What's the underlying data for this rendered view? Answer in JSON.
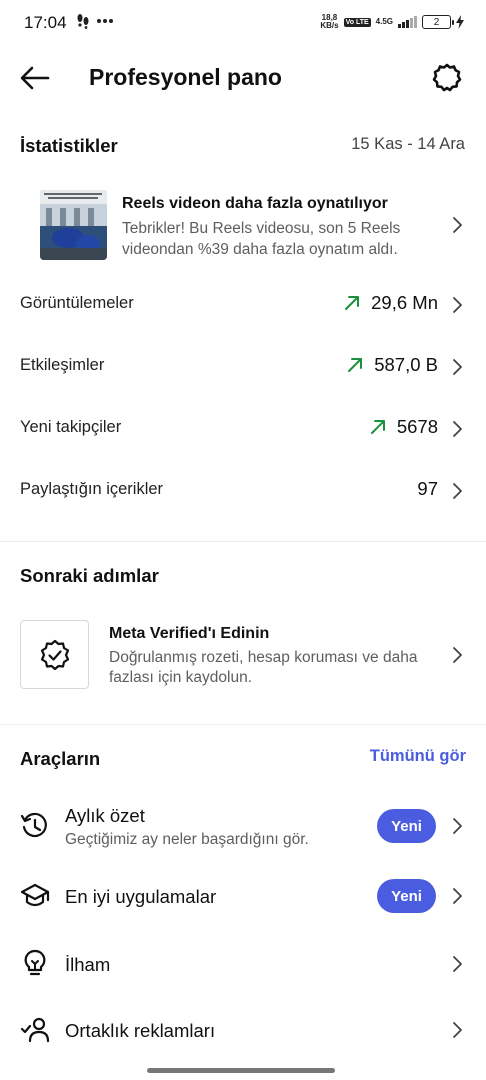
{
  "status_bar": {
    "time": "17:04",
    "net_speed_top": "18,8",
    "net_speed_bottom": "KB/s",
    "volte": "Vo LTE",
    "net_type": "4.5G",
    "battery": "2"
  },
  "header": {
    "title": "Profesyonel pano"
  },
  "stats": {
    "title": "İstatistikler",
    "date_range": "15 Kas - 14 Ara",
    "reel_card": {
      "title": "Reels videon daha fazla oynatılıyor",
      "description": "Tebrikler! Bu Reels videosu, son 5 Reels videondan %39 daha fazla oynatım aldı."
    },
    "rows": [
      {
        "label": "Görüntülemeler",
        "value": "29,6 Mn",
        "trend": "up"
      },
      {
        "label": "Etkileşimler",
        "value": "587,0 B",
        "trend": "up"
      },
      {
        "label": "Yeni takipçiler",
        "value": "5678",
        "trend": "up"
      },
      {
        "label": "Paylaştığın içerikler",
        "value": "97",
        "trend": "none"
      }
    ]
  },
  "next_steps": {
    "title": "Sonraki adımlar",
    "card": {
      "title": "Meta Verified'ı Edinin",
      "description": "Doğrulanmış rozeti, hesap koruması ve daha fazlası için kaydolun."
    }
  },
  "tools": {
    "title": "Araçların",
    "see_all": "Tümünü gör",
    "items": [
      {
        "label": "Aylık özet",
        "subtitle": "Geçtiğimiz ay neler başardığını gör.",
        "badge": "Yeni",
        "icon": "history-icon"
      },
      {
        "label": "En iyi uygulamalar",
        "subtitle": "",
        "badge": "Yeni",
        "icon": "graduation-cap-icon"
      },
      {
        "label": "İlham",
        "subtitle": "",
        "badge": "",
        "icon": "lightbulb-icon"
      },
      {
        "label": "Ortaklık reklamları",
        "subtitle": "",
        "badge": "",
        "icon": "partner-icon"
      }
    ]
  },
  "colors": {
    "accent": "#4a5de0",
    "trend_up": "#1a8f3c"
  }
}
